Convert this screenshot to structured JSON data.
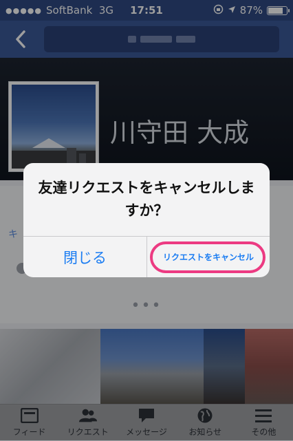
{
  "status_bar": {
    "signal": "●●●●●",
    "carrier": "SoftBank",
    "network": "3G",
    "time": "17:51",
    "battery_percent": "87%",
    "battery_level": 0.87
  },
  "profile": {
    "name": "川守田 大成"
  },
  "alert": {
    "message": "友達リクエストをキャンセルしますか？",
    "close_label": "閉じる",
    "cancel_request_label": "リクエストをキャンセル"
  },
  "partial": {
    "left_text": "キ",
    "dots": "•••"
  },
  "tab_bar": {
    "items": [
      {
        "label": "フィード",
        "icon": "feed-icon"
      },
      {
        "label": "リクエスト",
        "icon": "friends-icon"
      },
      {
        "label": "メッセージ",
        "icon": "message-icon"
      },
      {
        "label": "お知らせ",
        "icon": "globe-icon"
      },
      {
        "label": "その他",
        "icon": "menu-icon"
      }
    ]
  },
  "colors": {
    "facebook_blue": "#3b5998",
    "ios_link_blue": "#1a7cf2",
    "highlight_pink": "#ec3a82"
  }
}
